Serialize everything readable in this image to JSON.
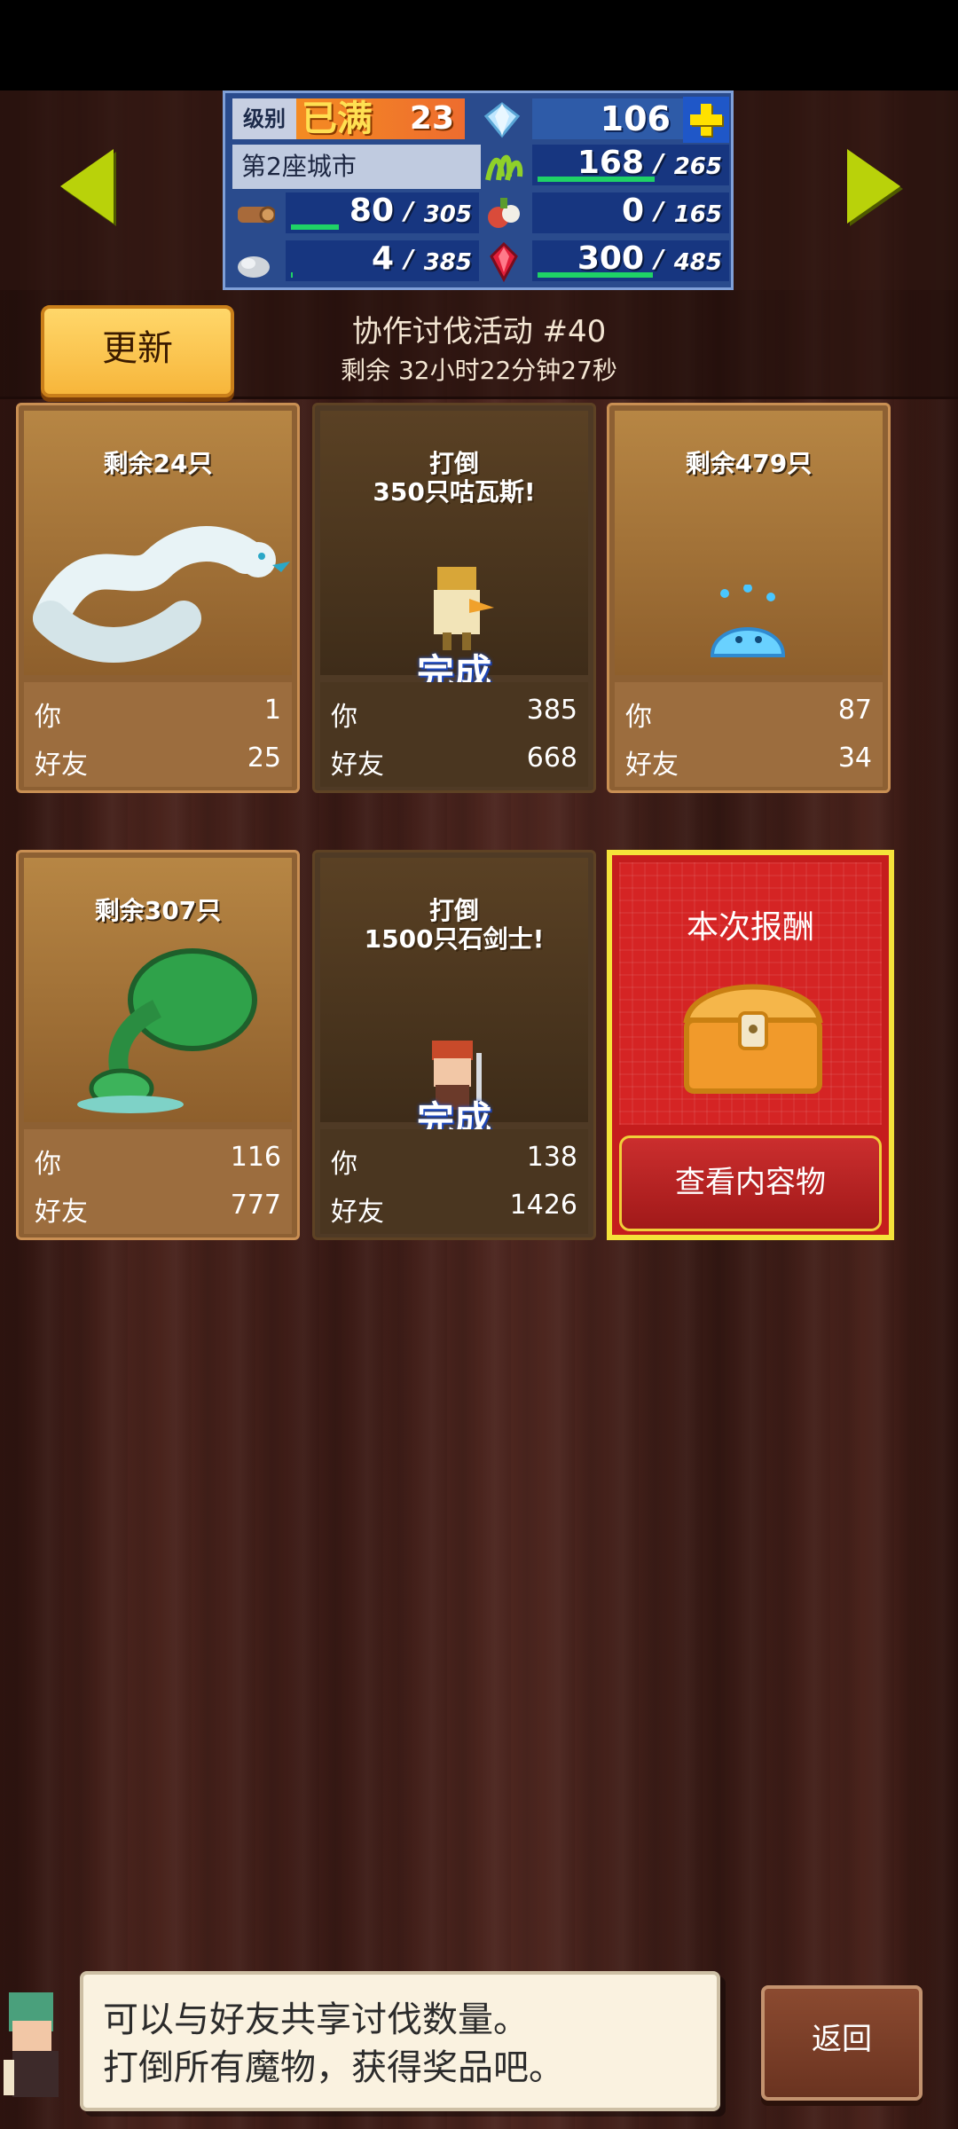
{
  "status": {
    "level_label": "级别",
    "level_max_text": "已满",
    "level_value": "23",
    "gems": "106",
    "city": "第2座城市",
    "resources": {
      "wood": {
        "current": "80",
        "max": "305",
        "fill": 0.26
      },
      "grass": {
        "current": "168",
        "max": "265",
        "fill": 0.63
      },
      "food": {
        "current": "0",
        "max": "165",
        "fill": 0.0
      },
      "stone": {
        "current": "4",
        "max": "385",
        "fill": 0.01
      },
      "ruby": {
        "current": "300",
        "max": "485",
        "fill": 0.62
      }
    }
  },
  "header": {
    "update_button": "更新",
    "event_title": "协作讨伐活动 #40",
    "time_left": "剩余 32小时22分钟27秒"
  },
  "cards": [
    {
      "title": "剩余24只",
      "done_text": "",
      "monster": "white-serpent",
      "you_label": "你",
      "you": "1",
      "friend_label": "好友",
      "friend": "25"
    },
    {
      "title": "打倒\n350只咕瓦斯!",
      "done_text": "完成",
      "monster": "bird-knight",
      "you_label": "你",
      "you": "385",
      "friend_label": "好友",
      "friend": "668"
    },
    {
      "title": "剩余479只",
      "done_text": "",
      "monster": "water-slime",
      "you_label": "你",
      "you": "87",
      "friend_label": "好友",
      "friend": "34"
    },
    {
      "title": "剩余307只",
      "done_text": "",
      "monster": "green-plant",
      "you_label": "你",
      "you": "116",
      "friend_label": "好友",
      "friend": "777"
    },
    {
      "title": "打倒\n1500只石剑士!",
      "done_text": "完成",
      "monster": "stone-swordsman",
      "you_label": "你",
      "you": "138",
      "friend_label": "好友",
      "friend": "1426"
    }
  ],
  "reward": {
    "title": "本次报酬",
    "button": "查看内容物"
  },
  "dialog": {
    "line1": "可以与好友共享讨伐数量。",
    "line2": "打倒所有魔物，获得奖品吧。"
  },
  "footer": {
    "back_button": "返回"
  }
}
